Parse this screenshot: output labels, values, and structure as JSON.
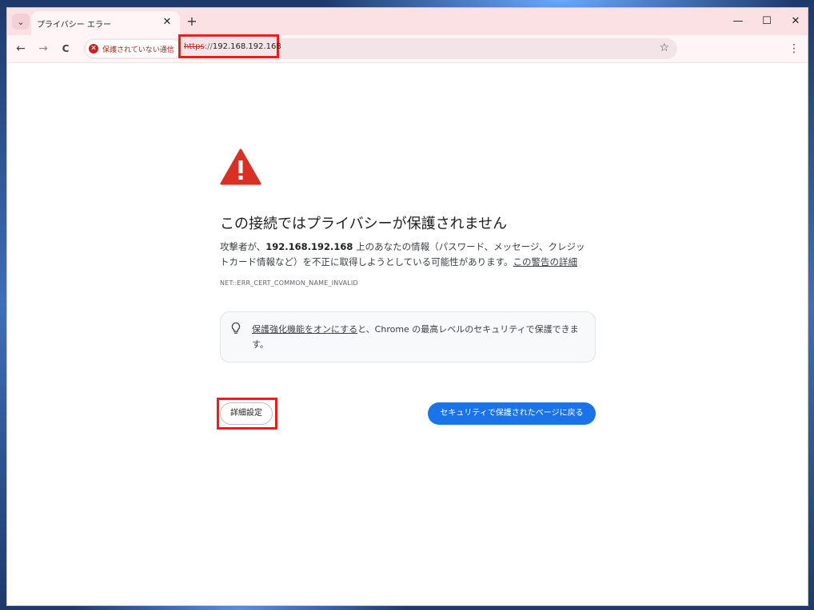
{
  "tab": {
    "title": "プライバシー エラー",
    "close_glyph": "✕",
    "new_tab_glyph": "+",
    "search_glyph": "⌄"
  },
  "window_controls": {
    "minimize": "—",
    "maximize": "☐",
    "close": "✕"
  },
  "toolbar": {
    "back": "←",
    "forward": "→",
    "reload": "C",
    "security_chip": "保護されていない通信",
    "security_icon": "✕",
    "url_scheme": "https",
    "url_sep": "://",
    "url_host": "192.168.192.168",
    "star_glyph": "☆",
    "menu_glyph": "⋮"
  },
  "page": {
    "heading": "この接続ではプライバシーが保護されません",
    "body_pre": "攻撃者が、",
    "body_host": "192.168.192.168",
    "body_post": " 上のあなたの情報（パスワード、メッセージ、クレジットカード情報など）を不正に取得しようとしている可能性があります。",
    "body_link": "この警告の詳細",
    "error_code": "NET::ERR_CERT_COMMON_NAME_INVALID",
    "hint_link": "保護強化機能をオンにする",
    "hint_post": "と、Chrome の最高レベルのセキュリティで保護できます。",
    "advanced_button": "詳細設定",
    "back_button": "セキュリティで保護されたページに戻る"
  },
  "colors": {
    "tabstrip": "#fbe0e4",
    "warning_red": "#d93025",
    "primary_blue": "#1a73e8",
    "highlight_red": "#ee1c1c"
  }
}
